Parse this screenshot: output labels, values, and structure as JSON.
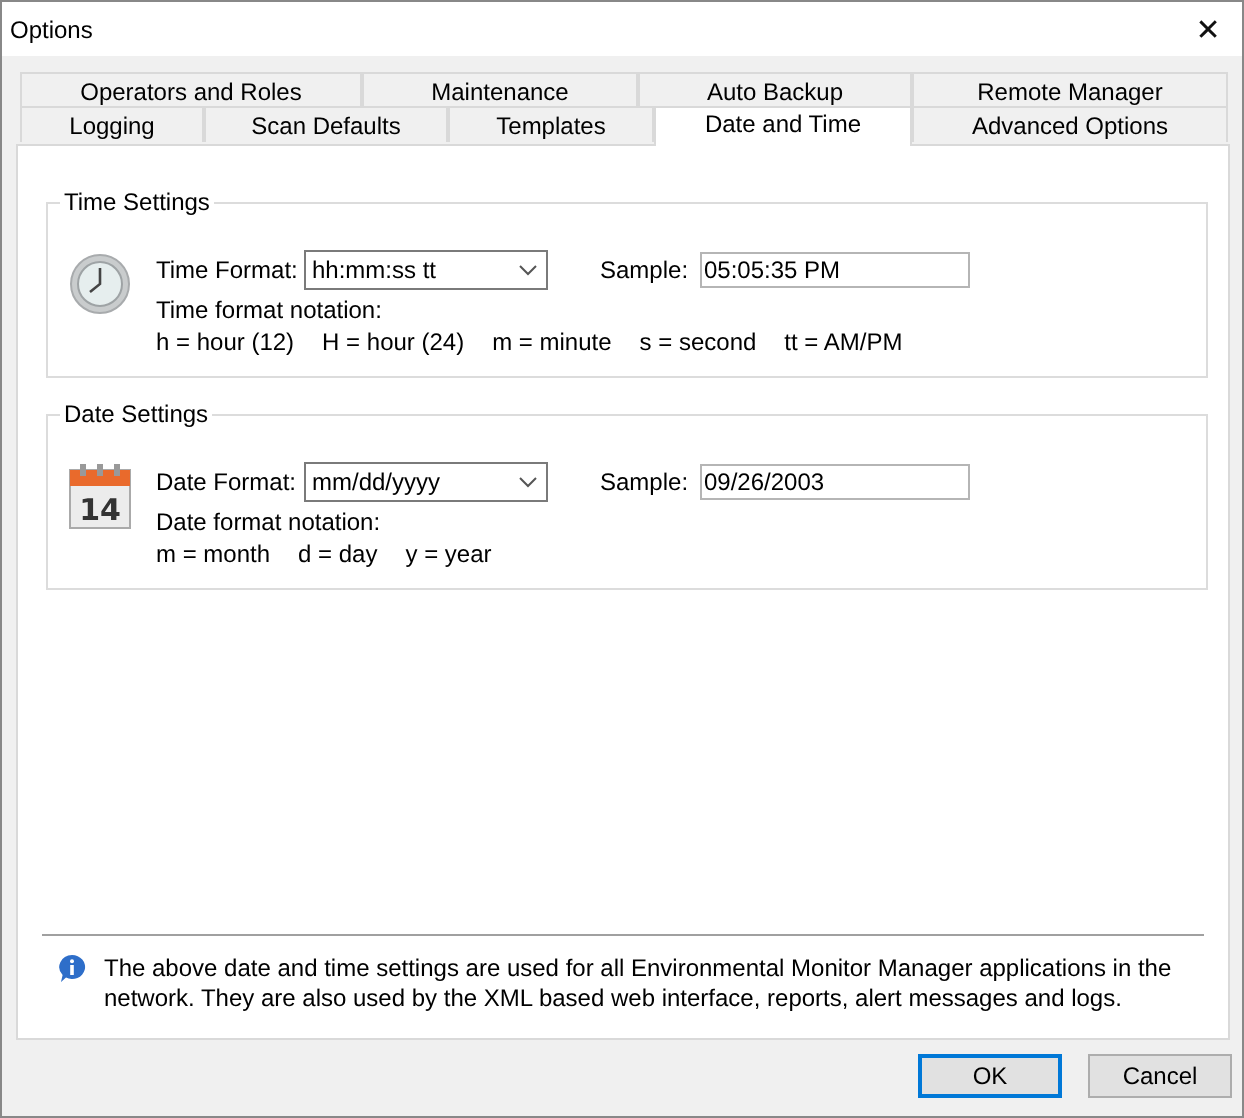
{
  "window": {
    "title": "Options",
    "close": "✕"
  },
  "tab_rows": [
    [
      {
        "label": "Operators and Roles",
        "selected": false
      },
      {
        "label": "Maintenance",
        "selected": false
      },
      {
        "label": "Auto Backup",
        "selected": false
      },
      {
        "label": "Remote Manager",
        "selected": false
      }
    ],
    [
      {
        "label": "Logging",
        "selected": false
      },
      {
        "label": "Scan Defaults",
        "selected": false
      },
      {
        "label": "Templates",
        "selected": false
      },
      {
        "label": "Date and Time",
        "selected": true
      },
      {
        "label": "Advanced Options",
        "selected": false
      }
    ]
  ],
  "groups": [
    {
      "kind": "clock",
      "title": "Time Settings",
      "format_label": "Time Format:",
      "format_value": "hh:mm:ss tt",
      "sample_label": "Sample:",
      "sample_value": "05:05:35 PM",
      "notation_title": "Time format notation:",
      "notation": [
        "h = hour (12)",
        "H = hour (24)",
        "m = minute",
        "s = second",
        "tt = AM/PM"
      ]
    },
    {
      "kind": "calendar",
      "calendar_day": "14",
      "title": "Date Settings",
      "format_label": "Date Format:",
      "format_value": "mm/dd/yyyy",
      "sample_label": "Sample:",
      "sample_value": "09/26/2003",
      "notation_title": "Date format notation:",
      "notation": [
        "m = month",
        "d = day",
        "y = year"
      ]
    }
  ],
  "info": "The above date and time settings are used for all Environmental Monitor Manager applications in the network. They are also used by the XML based web interface, reports, alert messages and logs.",
  "buttons": [
    {
      "label": "OK",
      "default": true
    },
    {
      "label": "Cancel",
      "default": false
    }
  ]
}
